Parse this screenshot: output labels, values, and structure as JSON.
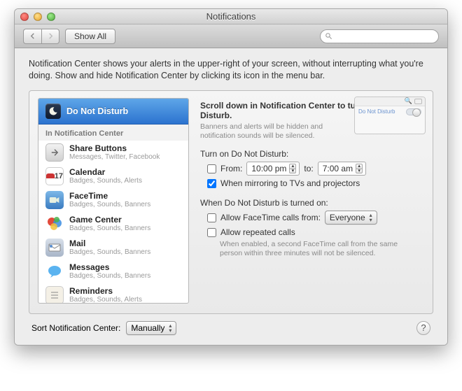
{
  "window": {
    "title": "Notifications",
    "show_all": "Show All"
  },
  "intro": "Notification Center shows your alerts in the upper-right of your screen, without interrupting what you're doing. Show and hide Notification Center by clicking its icon in the menu bar.",
  "sidebar": {
    "selected_label": "Do Not Disturb",
    "section_label": "In Notification Center",
    "items": [
      {
        "name": "Share Buttons",
        "sub": "Messages, Twitter, Facebook"
      },
      {
        "name": "Calendar",
        "sub": "Badges, Sounds, Alerts"
      },
      {
        "name": "FaceTime",
        "sub": "Badges, Sounds, Banners"
      },
      {
        "name": "Game Center",
        "sub": "Badges, Sounds, Banners"
      },
      {
        "name": "Mail",
        "sub": "Badges, Sounds, Banners"
      },
      {
        "name": "Messages",
        "sub": "Badges, Sounds, Banners"
      },
      {
        "name": "Reminders",
        "sub": "Badges, Sounds, Alerts"
      }
    ]
  },
  "settings": {
    "header1": "Scroll down in Notification Center to turn on Do Not Disturb.",
    "header1_sub": "Banners and alerts will be hidden and notification sounds will be silenced.",
    "turn_on_label": "Turn on Do Not Disturb:",
    "from_label": "From:",
    "from_time": "10:00 pm",
    "to_label": "to:",
    "to_time": "7:00 am",
    "mirroring_label": "When mirroring to TVs and projectors",
    "mirroring_checked": true,
    "section2": "When Do Not Disturb is turned on:",
    "allow_facetime_label": "Allow FaceTime calls from:",
    "facetime_popup": "Everyone",
    "allow_repeated_label": "Allow repeated calls",
    "repeated_hint": "When enabled, a second FaceTime call from the same person within three minutes will not be silenced.",
    "preview_dnd": "Do Not Disturb"
  },
  "footer": {
    "sort_label": "Sort Notification Center:",
    "sort_value": "Manually"
  }
}
